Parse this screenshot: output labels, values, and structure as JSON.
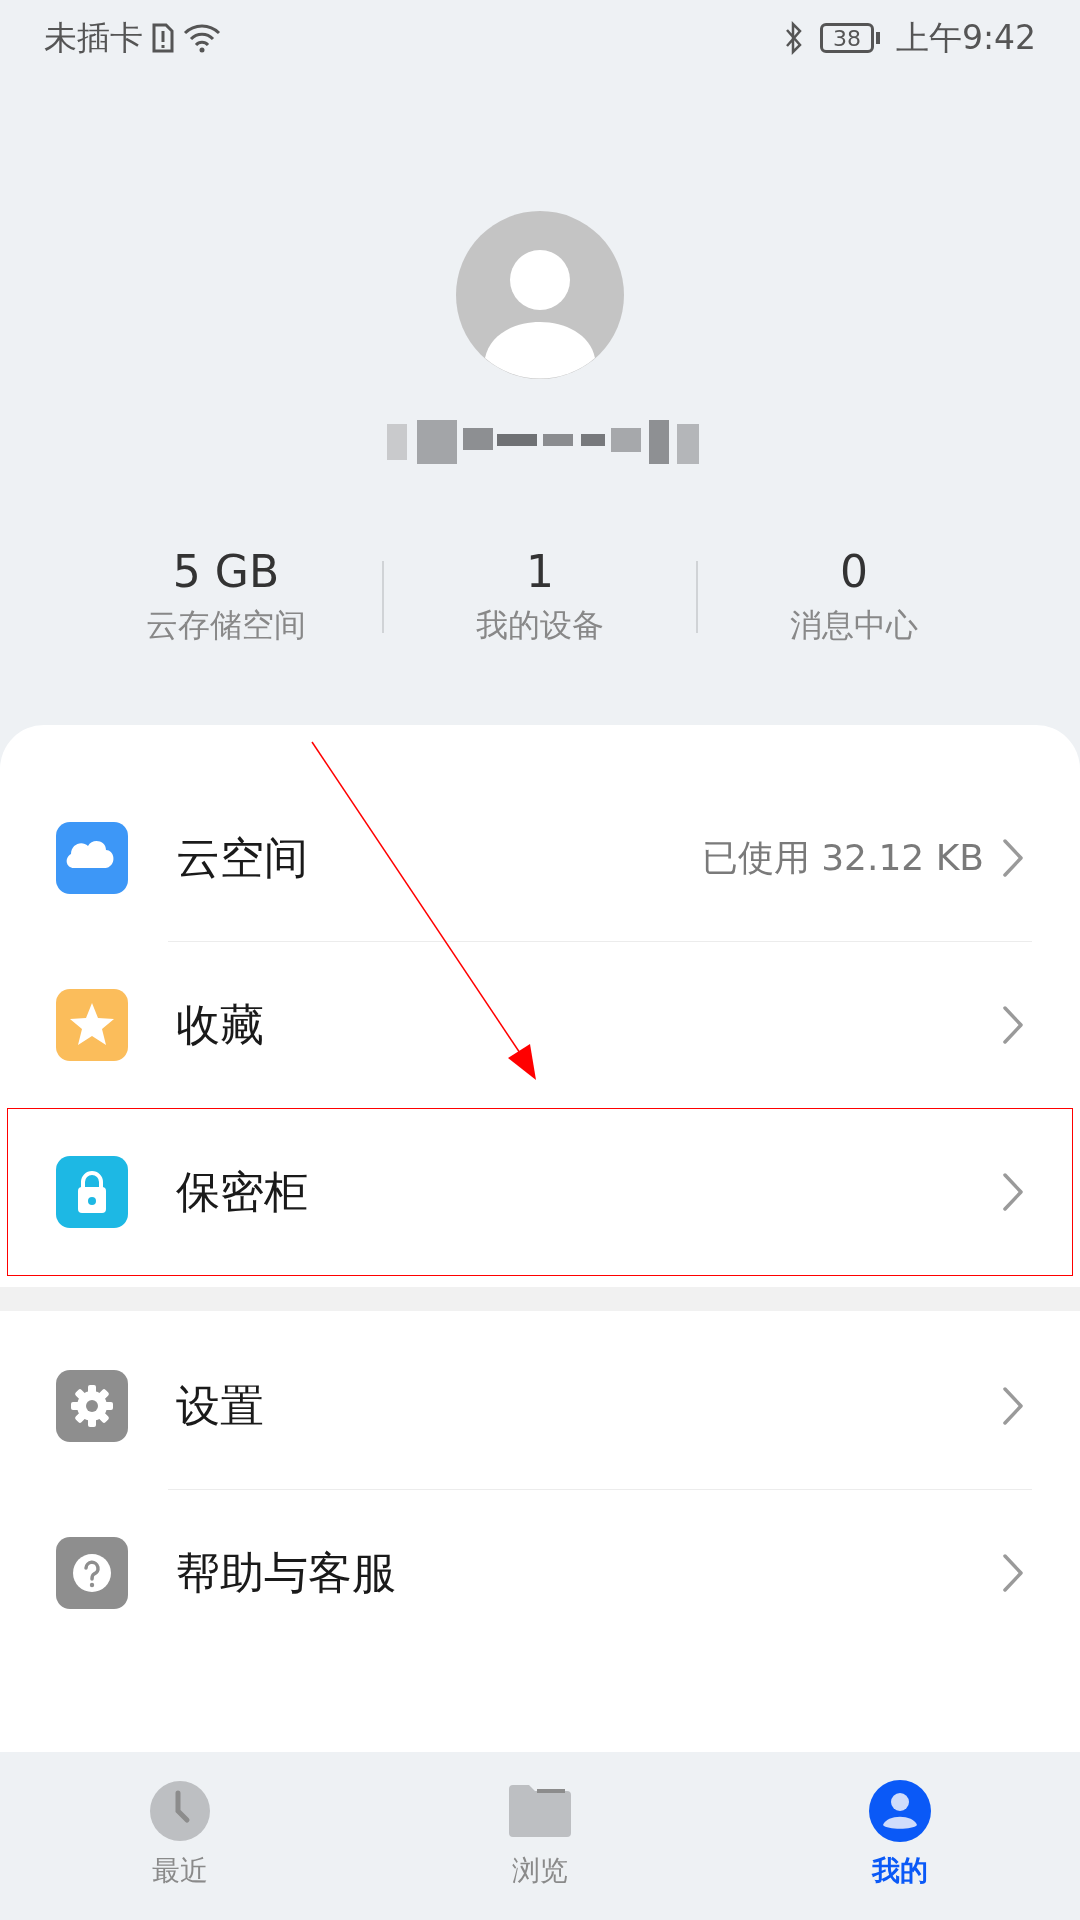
{
  "status_bar": {
    "carrier": "未插卡",
    "battery": "38",
    "time": "上午9:42"
  },
  "profile": {
    "stats": [
      {
        "value": "5 GB",
        "label": "云存储空间"
      },
      {
        "value": "1",
        "label": "我的设备"
      },
      {
        "value": "0",
        "label": "消息中心"
      }
    ]
  },
  "menu_groups": [
    [
      {
        "kind": "cloud",
        "label": "云空间",
        "detail": "已使用 32.12 KB",
        "highlighted": false
      },
      {
        "kind": "star",
        "label": "收藏",
        "highlighted": false
      },
      {
        "kind": "lock",
        "label": "保密柜",
        "highlighted": true
      }
    ],
    [
      {
        "kind": "gear",
        "label": "设置",
        "highlighted": false
      },
      {
        "kind": "help",
        "label": "帮助与客服",
        "highlighted": false
      }
    ]
  ],
  "bottom_nav": [
    {
      "kind": "clock",
      "label": "最近",
      "selected": false
    },
    {
      "kind": "folder",
      "label": "浏览",
      "selected": false
    },
    {
      "kind": "person",
      "label": "我的",
      "selected": true
    }
  ]
}
